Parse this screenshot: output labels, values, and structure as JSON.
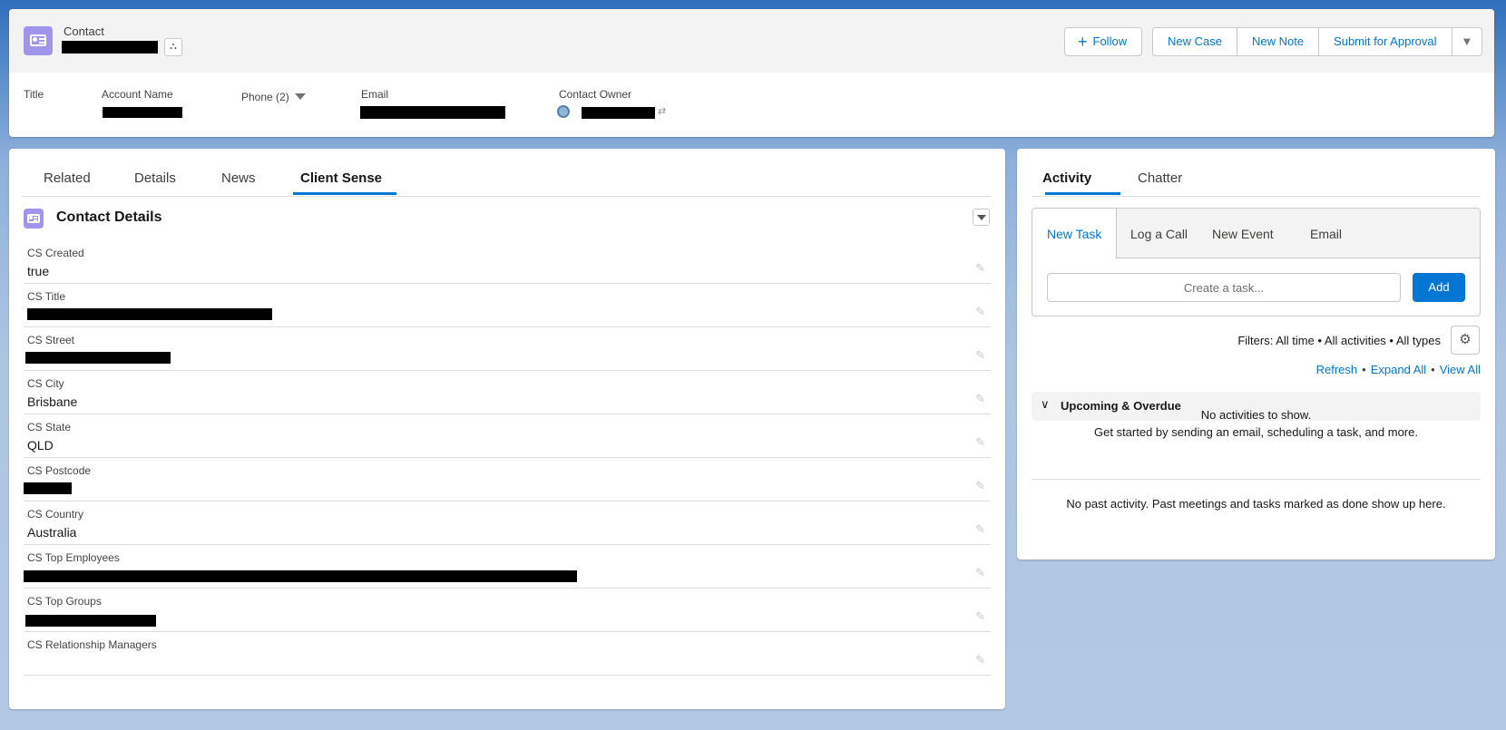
{
  "header": {
    "record_type": "Contact",
    "follow_label": "Follow",
    "actions": [
      "New Case",
      "New Note",
      "Submit for Approval"
    ],
    "highlights": {
      "title_label": "Title",
      "account_name_label": "Account Name",
      "phone_label": "Phone (2)",
      "email_label": "Email",
      "contact_owner_label": "Contact Owner"
    }
  },
  "main": {
    "tabs": [
      "Related",
      "Details",
      "News",
      "Client Sense"
    ],
    "active_tab": "Client Sense",
    "section_title": "Contact Details",
    "fields": [
      {
        "label": "CS Created",
        "value": "true"
      },
      {
        "label": "CS Title",
        "value": ""
      },
      {
        "label": "CS Street",
        "value": ""
      },
      {
        "label": "CS City",
        "value": "Brisbane"
      },
      {
        "label": "CS State",
        "value": "QLD"
      },
      {
        "label": "CS Postcode",
        "value": ""
      },
      {
        "label": "CS Country",
        "value": "Australia"
      },
      {
        "label": "CS Top Employees",
        "value": ""
      },
      {
        "label": "CS Top Groups",
        "value": ""
      },
      {
        "label": "CS Relationship Managers",
        "value": ""
      }
    ]
  },
  "activity": {
    "tabs": [
      "Activity",
      "Chatter"
    ],
    "active_tab": "Activity",
    "composer_tabs": [
      "New Task",
      "Log a Call",
      "New Event",
      "Email"
    ],
    "task_placeholder": "Create a task...",
    "add_label": "Add",
    "filters_text": "Filters: All time • All activities • All types",
    "links": [
      "Refresh",
      "Expand All",
      "View All"
    ],
    "upcoming_label": "Upcoming & Overdue",
    "empty_line1": "No activities to show.",
    "empty_line2": "Get started by sending an email, scheduling a task, and more.",
    "past_text": "No past activity. Past meetings and tasks marked as done show up here."
  },
  "colors": {
    "brand_blue": "#0176d3",
    "contact_icon": "#a094ed",
    "background_top": "#2f6fba",
    "background_bottom": "#b3c8e4"
  },
  "icons": [
    "contact-card-icon",
    "hierarchy-icon",
    "plus-icon",
    "chevron-down-icon",
    "pencil-icon",
    "gear-icon",
    "avatar-icon"
  ]
}
